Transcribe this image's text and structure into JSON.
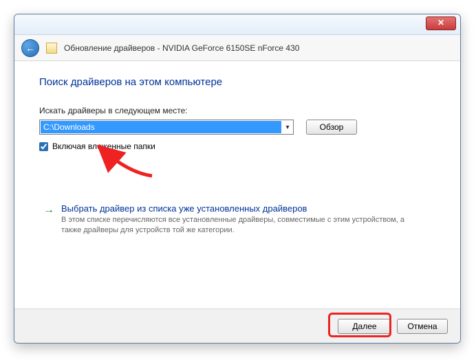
{
  "window": {
    "title": "Обновление драйверов - NVIDIA GeForce 6150SE nForce 430",
    "close_glyph": "✕"
  },
  "back_glyph": "←",
  "heading": "Поиск драйверов на этом компьютере",
  "path_label": "Искать драйверы в следующем месте:",
  "path_value": "C:\\Downloads",
  "dropdown_glyph": "▾",
  "browse_label": "Обзор",
  "include_sub": {
    "checked": true,
    "label": "Включая вложенные папки"
  },
  "option": {
    "arrow_glyph": "→",
    "title": "Выбрать драйвер из списка уже установленных драйверов",
    "desc": "В этом списке перечисляются все установленные драйверы, совместимые с этим устройством, а также драйверы для устройств той же категории."
  },
  "footer": {
    "next": "Далее",
    "cancel": "Отмена"
  }
}
